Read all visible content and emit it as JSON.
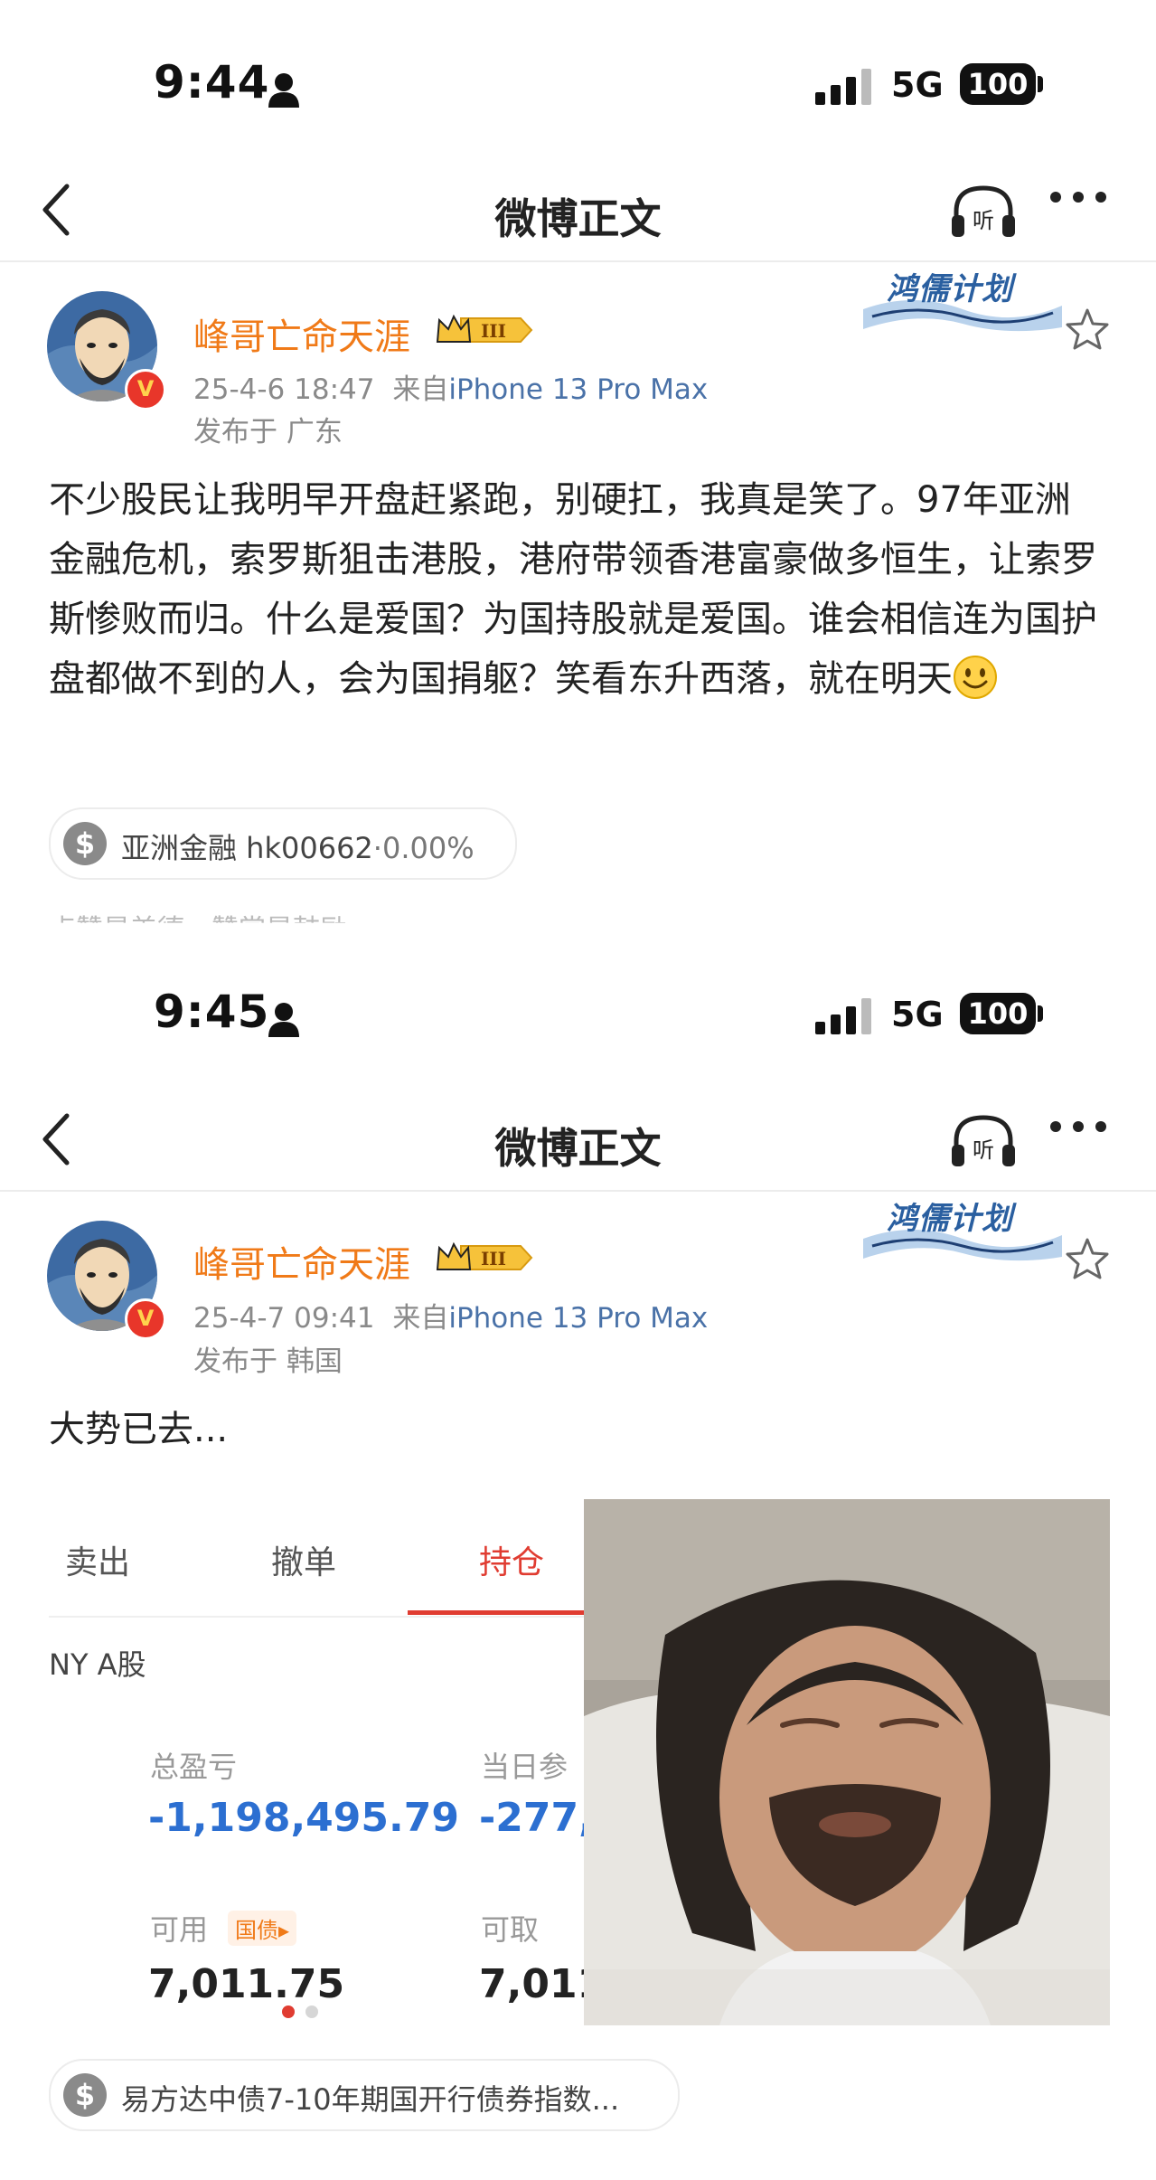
{
  "screens": [
    {
      "status": {
        "time": "9:44",
        "network": "5G",
        "battery": "100"
      },
      "nav": {
        "title": "微博正文"
      },
      "post": {
        "username": "峰哥亡命天涯",
        "vip_badge": "III",
        "date": "25-4-6 18:47",
        "source_prefix": "来自",
        "device": "iPhone 13 Pro Max",
        "location": "发布于 广东",
        "banner": "鸿儒计划",
        "text": "不少股民让我明早开盘赶紧跑，别硬扛，我真是笑了。97年亚洲金融危机，索罗斯狙击港股，港府带领香港富豪做多恒生，让索罗斯惨败而归。什么是爱国？为国持股就是爱国。谁会相信连为国护盘都做不到的人，会为国捐躯？笑看东升西落，就在明天",
        "stock_tag": {
          "name": "亚洲金融 hk00662",
          "separator": "·",
          "change": "0.00%"
        },
        "cut_off_row": "点赞是美德，赞赏是鼓励"
      }
    },
    {
      "status": {
        "time": "9:45",
        "network": "5G",
        "battery": "100"
      },
      "nav": {
        "title": "微博正文"
      },
      "post": {
        "username": "峰哥亡命天涯",
        "vip_badge": "III",
        "date": "25-4-7 09:41",
        "source_prefix": "来自",
        "device": "iPhone 13 Pro Max",
        "location": "发布于 韩国",
        "banner": "鸿儒计划",
        "text": "大势已去...",
        "trading_screenshot": {
          "tabs": [
            "卖出",
            "撤单",
            "持仓"
          ],
          "active_tab": "持仓",
          "account": "NY A股",
          "total_pnl_label": "总盈亏",
          "total_pnl_value": "-1,198,495.79",
          "daily_label": "当日参",
          "daily_value": "-277,",
          "available_label": "可用",
          "available_chip": "国债▸",
          "available_value": "7,011.75",
          "withdrawable_label": "可取",
          "withdrawable_value": "7,011"
        },
        "stock_tag": {
          "name": "易方达中债7-10年期国开行债券指数..."
        }
      }
    }
  ],
  "colors": {
    "username": "#f07a18",
    "device_link": "#4a72a8",
    "accent_red": "#e03c31",
    "loss_blue": "#2c6fd1"
  },
  "icons": [
    "back-chevron-icon",
    "headphones-listen-icon",
    "more-dots-icon",
    "star-icon",
    "person-icon",
    "signal-icon",
    "dollar-icon",
    "verified-v-icon",
    "smiley-emoji-icon"
  ]
}
